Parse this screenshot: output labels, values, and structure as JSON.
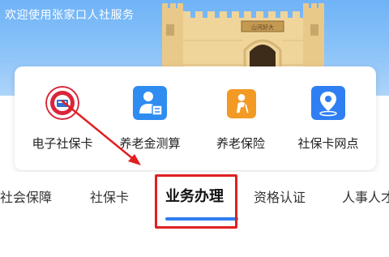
{
  "header": {
    "welcome_text": "欢迎使用张家口人社服务",
    "gate_sign": "山河好大"
  },
  "services": [
    {
      "label": "电子社保卡",
      "icon": "social-security-badge-icon",
      "color": "#d9253a"
    },
    {
      "label": "养老金测算",
      "icon": "person-calculator-icon",
      "color": "#2f8cf0"
    },
    {
      "label": "养老保险",
      "icon": "elderly-person-icon",
      "color": "#f29a24"
    },
    {
      "label": "社保卡网点",
      "icon": "location-pin-icon",
      "color": "#2f7ff2"
    }
  ],
  "tabs": [
    {
      "label": "社会保障",
      "active": false
    },
    {
      "label": "社保卡",
      "active": false
    },
    {
      "label": "业务办理",
      "active": true
    },
    {
      "label": "资格认证",
      "active": false
    },
    {
      "label": "人事人才",
      "active": false
    }
  ],
  "colors": {
    "accent": "#2e7df0",
    "annotation": "#e02020"
  }
}
